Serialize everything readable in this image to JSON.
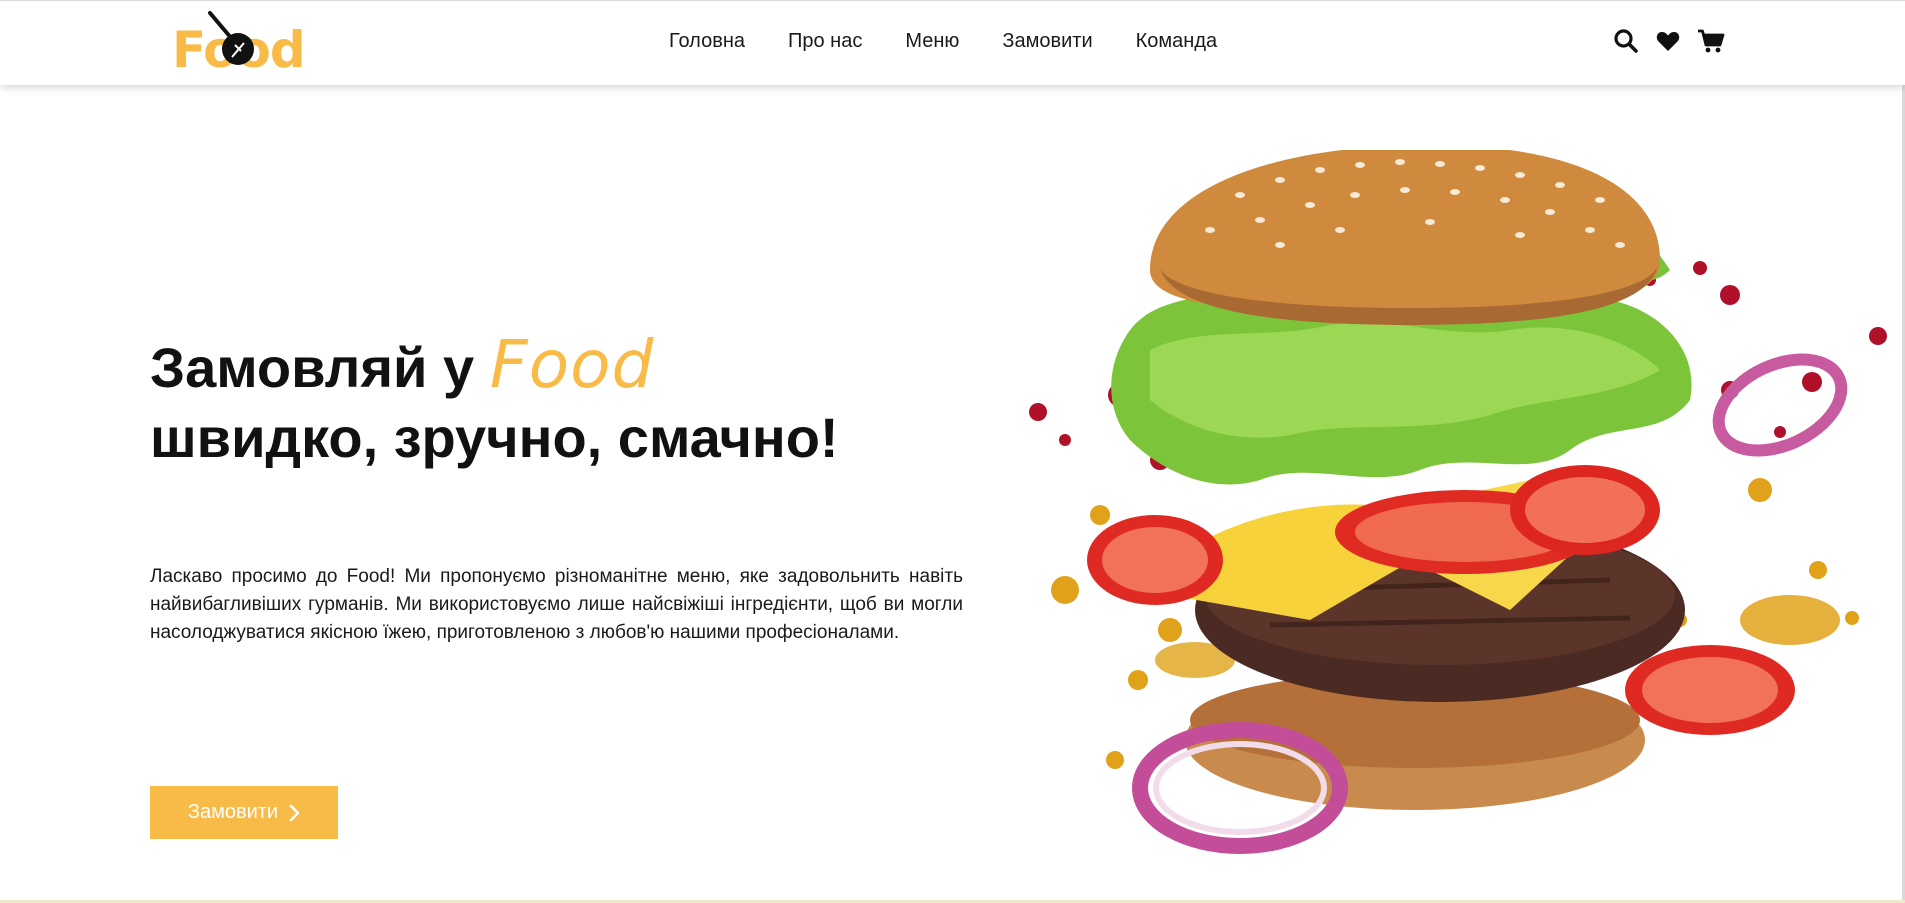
{
  "logo": {
    "text": "Food",
    "icon": "frying-pan-icon"
  },
  "nav": {
    "items": [
      {
        "label": "Головна"
      },
      {
        "label": "Про нас"
      },
      {
        "label": "Меню"
      },
      {
        "label": "Замовити"
      },
      {
        "label": "Команда"
      }
    ]
  },
  "header_icons": [
    "search-icon",
    "heart-icon",
    "cart-icon"
  ],
  "hero": {
    "title_prefix": "Замовляй у",
    "title_brand": "Food",
    "title_line2": "швидко, зручно, смачно!",
    "description": "Ласкаво просимо до Food! Ми пропонуємо різноманітне меню, яке задовольнить навіть найвибагливіших гурманів. Ми використовуємо лише найсвіжіші інгредієнти, щоб ви могли насолоджуватися якісною їжею, приготовленою з любов'ю нашими професіоналами.",
    "button_label": "Замовити",
    "button_icon": "chevron-right-icon",
    "image": "burger-image"
  },
  "colors": {
    "accent": "#f9bb47",
    "text": "#111111",
    "background": "#ffffff"
  }
}
